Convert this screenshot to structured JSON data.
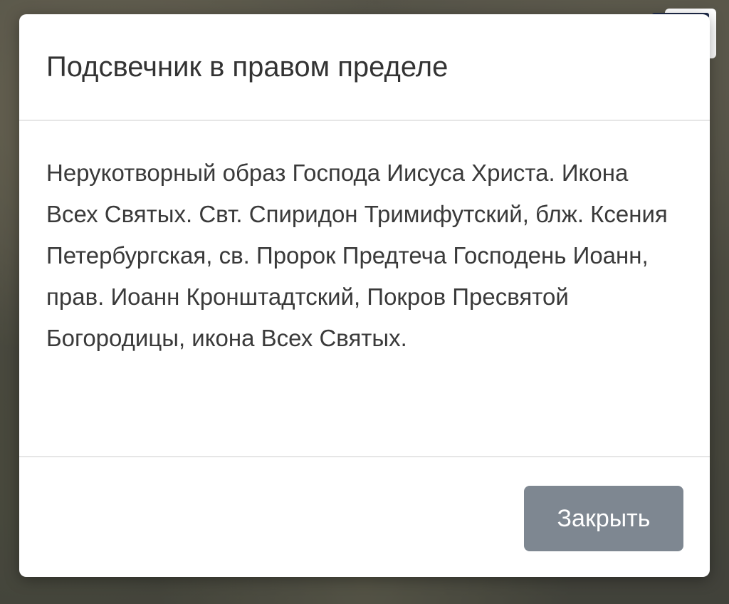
{
  "modal": {
    "title": "Подсвечник в правом пределе",
    "body": "Нерукотворный образ Господа Иисуса Христа. Икона Всех Святых. Свт. Спиридон Тримифутский, блж. Ксения Петербургская, св. Пророк Предтеча Господень Иоанн, прав. Иоанн Кронштадтский, Покров Пресвятой Богородицы, икона Всех Святых.",
    "close_label": "Закрыть"
  },
  "colors": {
    "title_text": "#333333",
    "body_text": "#3a3a3a",
    "close_button_bg": "#7e8791",
    "menu_icon": "#1f2b4a"
  },
  "icons": {
    "menu": "hamburger-menu-icon"
  }
}
